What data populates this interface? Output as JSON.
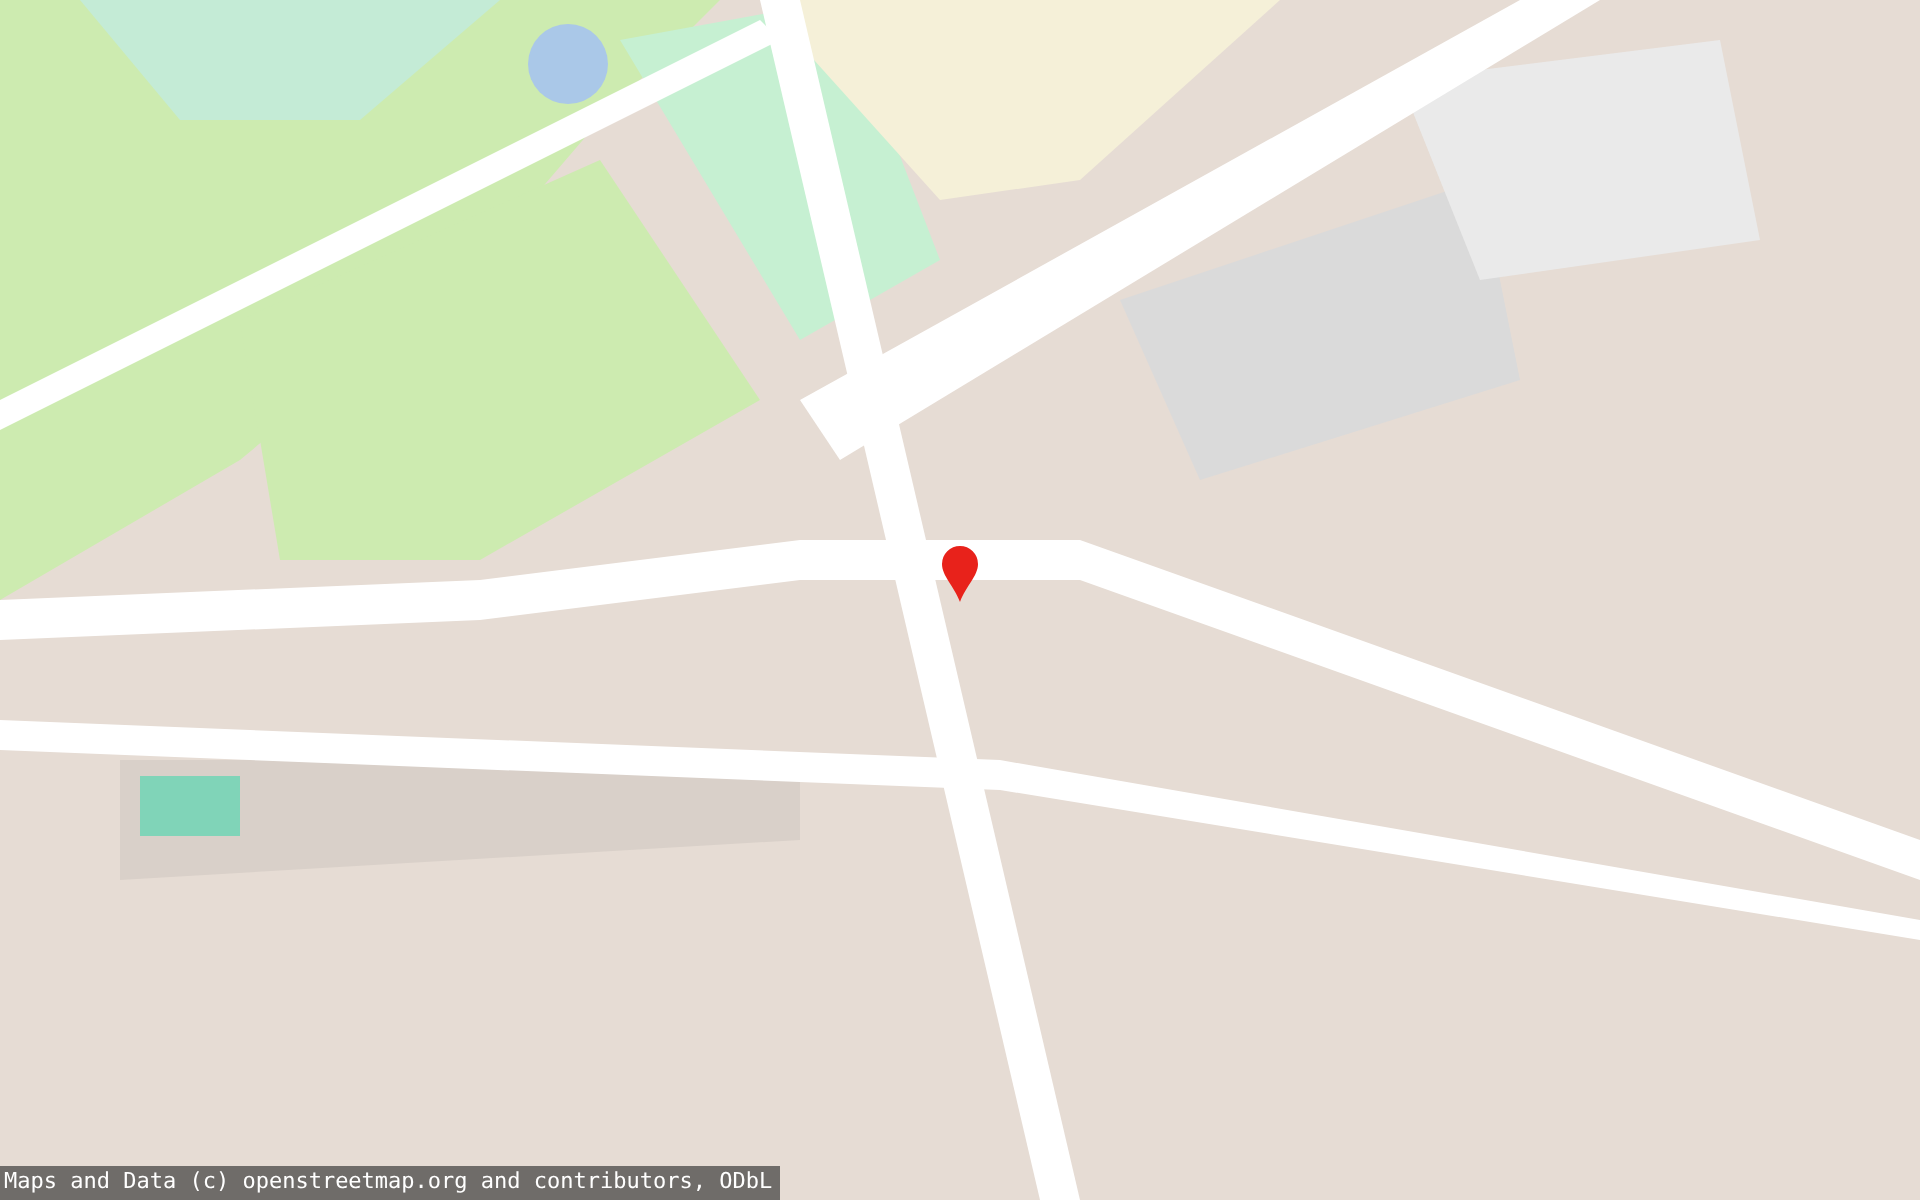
{
  "marker": {
    "color": "#e8221b"
  },
  "attribution": {
    "text": "Maps and Data (c) openstreetmap.org and contributors, ODbL"
  }
}
